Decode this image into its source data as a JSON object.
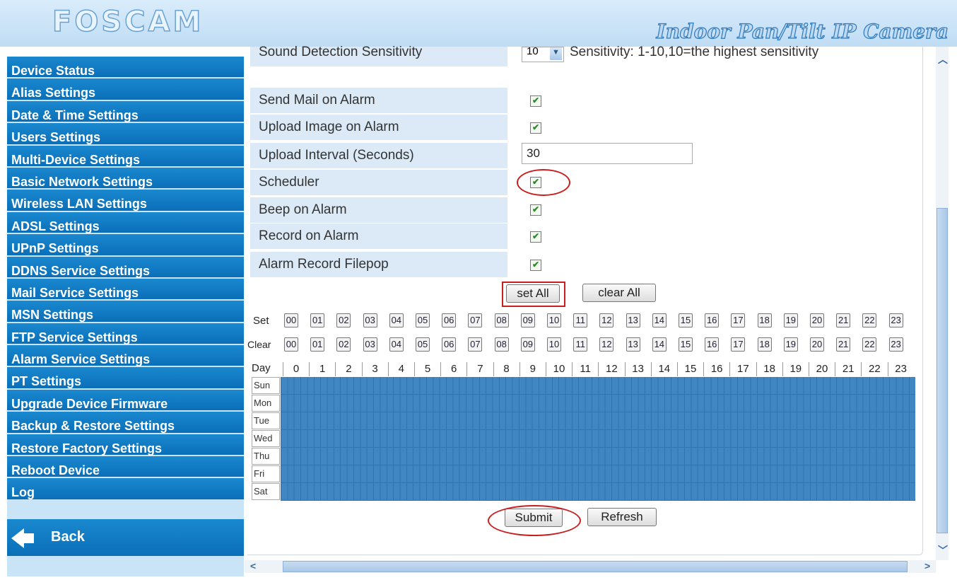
{
  "header": {
    "logo": "FOSCAM",
    "product": "Indoor Pan/Tilt IP Camera"
  },
  "sidebar": {
    "items": [
      {
        "label": "Device Status",
        "name": "sidebar-item-device-status"
      },
      {
        "label": "Alias Settings",
        "name": "sidebar-item-alias-settings"
      },
      {
        "label": "Date & Time Settings",
        "name": "sidebar-item-date-time-settings"
      },
      {
        "label": "Users Settings",
        "name": "sidebar-item-users-settings"
      },
      {
        "label": "Multi-Device Settings",
        "name": "sidebar-item-multi-device-settings"
      },
      {
        "label": "Basic Network Settings",
        "name": "sidebar-item-basic-network-settings"
      },
      {
        "label": "Wireless LAN Settings",
        "name": "sidebar-item-wireless-lan-settings"
      },
      {
        "label": "ADSL Settings",
        "name": "sidebar-item-adsl-settings"
      },
      {
        "label": "UPnP Settings",
        "name": "sidebar-item-upnp-settings"
      },
      {
        "label": "DDNS Service Settings",
        "name": "sidebar-item-ddns-service-settings"
      },
      {
        "label": "Mail Service Settings",
        "name": "sidebar-item-mail-service-settings"
      },
      {
        "label": "MSN Settings",
        "name": "sidebar-item-msn-settings"
      },
      {
        "label": "FTP Service Settings",
        "name": "sidebar-item-ftp-service-settings"
      },
      {
        "label": "Alarm Service Settings",
        "name": "sidebar-item-alarm-service-settings"
      },
      {
        "label": "PT Settings",
        "name": "sidebar-item-pt-settings"
      },
      {
        "label": "Upgrade Device Firmware",
        "name": "sidebar-item-upgrade-device-firmware"
      },
      {
        "label": "Backup & Restore Settings",
        "name": "sidebar-item-backup-restore-settings"
      },
      {
        "label": "Restore Factory Settings",
        "name": "sidebar-item-restore-factory-settings"
      },
      {
        "label": "Reboot Device",
        "name": "sidebar-item-reboot-device"
      },
      {
        "label": "Log",
        "name": "sidebar-item-log"
      }
    ],
    "back_label": "Back"
  },
  "form": {
    "sound_sensitivity": {
      "label": "Sound Detection Sensitivity",
      "value": "10",
      "hint": "Sensitivity: 1-10,10=the highest sensitivity"
    },
    "send_mail": {
      "label": "Send Mail on Alarm",
      "checked": true
    },
    "upload_image": {
      "label": "Upload Image on Alarm",
      "checked": true
    },
    "upload_interval": {
      "label": "Upload Interval (Seconds)",
      "value": "30"
    },
    "scheduler": {
      "label": "Scheduler",
      "checked": true
    },
    "beep": {
      "label": "Beep on Alarm",
      "checked": true
    },
    "record": {
      "label": "Record on Alarm",
      "checked": true
    },
    "filepop": {
      "label": "Alarm Record Filepop",
      "checked": true
    },
    "check_glyph": "✔"
  },
  "schedule": {
    "set_all_label": "set All",
    "clear_all_label": "clear All",
    "set_row_label": "Set",
    "clear_row_label": "Clear",
    "day_row_label": "Day",
    "hour_buttons": [
      "00",
      "01",
      "02",
      "03",
      "04",
      "05",
      "06",
      "07",
      "08",
      "09",
      "10",
      "11",
      "12",
      "13",
      "14",
      "15",
      "16",
      "17",
      "18",
      "19",
      "20",
      "21",
      "22",
      "23"
    ],
    "hours": [
      "0",
      "1",
      "2",
      "3",
      "4",
      "5",
      "6",
      "7",
      "8",
      "9",
      "10",
      "11",
      "12",
      "13",
      "14",
      "15",
      "16",
      "17",
      "18",
      "19",
      "20",
      "21",
      "22",
      "23"
    ],
    "days": [
      "Sun",
      "Mon",
      "Tue",
      "Wed",
      "Thu",
      "Fri",
      "Sat"
    ],
    "all_selected": true,
    "selected_color": "#3f86c3"
  },
  "actions": {
    "submit_label": "Submit",
    "refresh_label": "Refresh"
  }
}
